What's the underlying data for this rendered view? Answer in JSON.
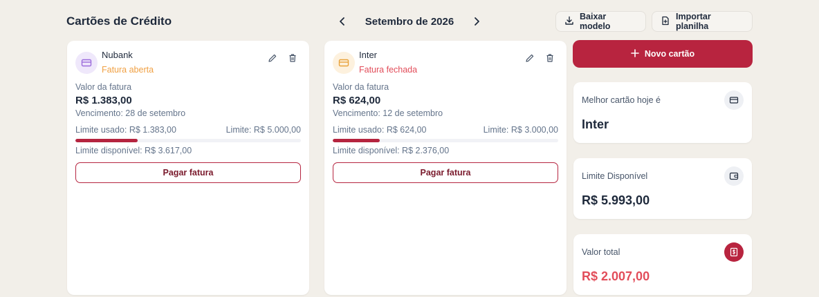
{
  "page": {
    "title": "Cartões de Crédito"
  },
  "month_nav": {
    "label": "Setembro de 2026",
    "prev_icon": "chevron-left-icon",
    "next_icon": "chevron-right-icon"
  },
  "toolbar": {
    "download_label": "Baixar modelo",
    "import_label": "Importar planilha"
  },
  "cards": [
    {
      "name": "Nubank",
      "status": "Fatura aberta",
      "status_color": "#f0a043",
      "badge_bg": "#efe8fb",
      "badge_icon_color": "#9b6bdb",
      "invoice_label": "Valor da fatura",
      "invoice_amount": "R$ 1.383,00",
      "due": "Vencimento: 28 de setembro",
      "used": "Limite usado: R$ 1.383,00",
      "limit": "Limite: R$ 5.000,00",
      "usage_fraction": 0.2766,
      "available": "Limite disponível: R$ 3.617,00",
      "pay_label": "Pagar fatura"
    },
    {
      "name": "Inter",
      "status": "Fatura fechada",
      "status_color": "#e24d5a",
      "badge_bg": "#fdf1de",
      "badge_icon_color": "#e8a23a",
      "invoice_label": "Valor da fatura",
      "invoice_amount": "R$ 624,00",
      "due": "Vencimento: 12 de setembro",
      "used": "Limite usado: R$ 624,00",
      "limit": "Limite: R$ 3.000,00",
      "usage_fraction": 0.208,
      "available": "Limite disponível: R$ 2.376,00",
      "pay_label": "Pagar fatura"
    }
  ],
  "new_card": {
    "label": "Novo cartão"
  },
  "stats": {
    "best": {
      "label": "Melhor cartão hoje é",
      "value": "Inter"
    },
    "limit": {
      "label": "Limite Disponível",
      "value": "R$ 5.993,00"
    },
    "total": {
      "label": "Valor total",
      "value": "R$ 2.007,00"
    }
  },
  "colors": {
    "accent": "#b8243f",
    "background": "#f2efe9",
    "danger_text": "#e24d5a"
  }
}
